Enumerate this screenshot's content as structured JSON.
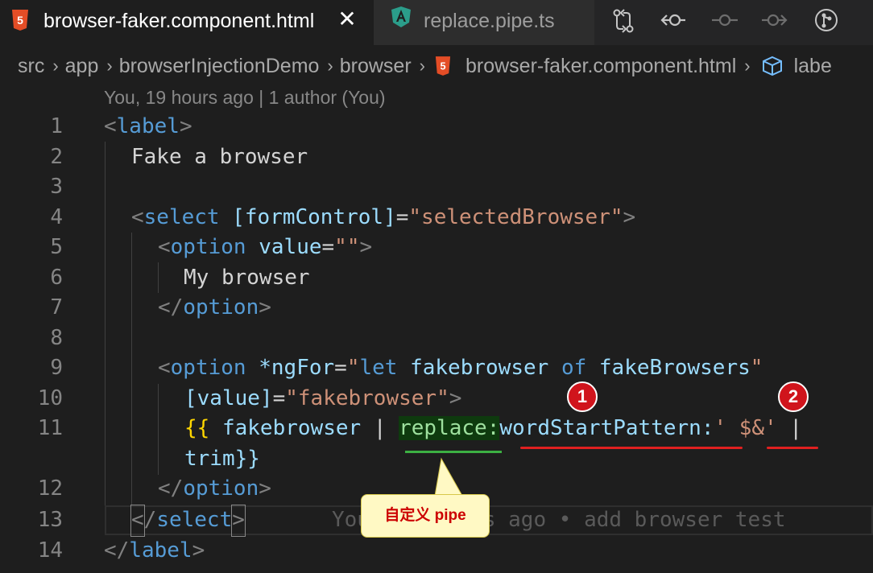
{
  "tabs": [
    {
      "label": "browser-faker.component.html",
      "icon": "html5-icon",
      "active": true
    },
    {
      "label": "replace.pipe.ts",
      "icon": "angular-icon",
      "active": false
    }
  ],
  "tab_close_glyph": "✕",
  "toolbar_icons": [
    "git-compare-icon",
    "go-back-icon",
    "git-commit-icon",
    "go-forward-icon",
    "source-control-icon"
  ],
  "breadcrumb": [
    "src",
    "app",
    "browserInjectionDemo",
    "browser",
    "browser-faker.component.html",
    "labe"
  ],
  "blame": "You, 19 hours ago | 1 author (You)",
  "line_numbers": [
    "1",
    "2",
    "3",
    "4",
    "5",
    "6",
    "7",
    "8",
    "9",
    "10",
    "11",
    "12",
    "13",
    "14"
  ],
  "code": {
    "l1": {
      "open": "<",
      "tag": "label",
      "close": ">"
    },
    "l2": "Fake a browser",
    "l4": {
      "open": "<",
      "tag": "select",
      "attr": "[formControl]",
      "eq": "=",
      "val": "\"selectedBrowser\"",
      "close": ">"
    },
    "l5": {
      "open": "<",
      "tag": "option",
      "attr": "value",
      "eq": "=",
      "val": "\"\"",
      "close": ">"
    },
    "l6": "My browser",
    "l7": {
      "open": "</",
      "tag": "option",
      "close": ">"
    },
    "l9": {
      "open": "<",
      "tag": "option",
      "attr": "*ngFor",
      "eq": "=",
      "val_q1": "\"",
      "kw_let": "let",
      "var1": "fakebrowser",
      "kw_of": "of",
      "var2": "fakeBrowsers",
      "val_q2": "\""
    },
    "l10": {
      "attr": "[value]",
      "eq": "=",
      "val": "\"fakebrowser\"",
      "close": ">"
    },
    "l11": {
      "open": "{{",
      "var": "fakebrowser",
      "pipe1": "|",
      "replace": "replace:",
      "arg": "wordStartPattern:",
      "str": "' $&'",
      "pipe2": "|"
    },
    "l11b": "trim}}",
    "l12": {
      "open": "</",
      "tag": "option",
      "close": ">"
    },
    "l13": {
      "lt": "<",
      "slash": "/",
      "tag": "select",
      "close": ">",
      "ghost": "You, 19 hours ago • add browser test"
    },
    "l14": {
      "open": "</",
      "tag": "label",
      "close": ">"
    }
  },
  "annotations": {
    "badge1": "1",
    "badge2": "2",
    "callout": "自定义 pipe",
    "colors": {
      "green": "#3cb043",
      "red": "#e02020",
      "callout_bg": "#fff9c4"
    }
  }
}
